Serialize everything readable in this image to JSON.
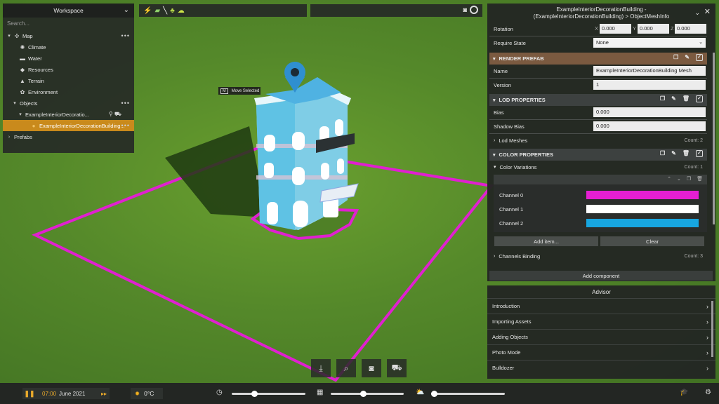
{
  "workspace": {
    "title": "Workspace",
    "search_placeholder": "Search...",
    "tree": [
      {
        "label": "Map",
        "icon": "map-icon",
        "twisty": "▾",
        "depth": 0
      },
      {
        "label": "Climate",
        "icon": "climate-icon",
        "twisty": "",
        "depth": 1
      },
      {
        "label": "Water",
        "icon": "water-icon",
        "twisty": "",
        "depth": 1
      },
      {
        "label": "Resources",
        "icon": "resources-icon",
        "twisty": "",
        "depth": 1
      },
      {
        "label": "Terrain",
        "icon": "terrain-icon",
        "twisty": "",
        "depth": 1
      },
      {
        "label": "Environment",
        "icon": "environment-icon",
        "twisty": "",
        "depth": 1
      },
      {
        "label": "Objects",
        "icon": "",
        "twisty": "▾",
        "depth": 1
      },
      {
        "label": "ExampleInteriorDecoratio...",
        "icon": "",
        "twisty": "▾",
        "depth": 2
      },
      {
        "label": "ExampleInteriorDecorationBuilding...",
        "icon": "dot-icon",
        "twisty": "",
        "depth": 3,
        "selected": true
      },
      {
        "label": "Prefabs",
        "icon": "",
        "twisty": "›",
        "depth": 0
      }
    ]
  },
  "tooltip": {
    "key": "M",
    "text": "Move Selected"
  },
  "inspector": {
    "title_line1": "ExampleInteriorDecorationBuilding -",
    "title_line2": "(ExampleInteriorDecorationBuilding) > ObjectMeshInfo",
    "rotation_label": "Rotation",
    "rotation": {
      "x_label": "X",
      "x": "0.000",
      "y_label": "Y",
      "y": "0.000",
      "z_label": "Z",
      "z": "0.000"
    },
    "require_state_label": "Require State",
    "require_state_value": "None",
    "render_prefab_title": "RENDER PREFAB",
    "name_label": "Name",
    "name_value": "ExampleInteriorDecorationBuilding Mesh",
    "version_label": "Version",
    "version_value": "1",
    "lod_title": "LOD PROPERTIES",
    "bias_label": "Bias",
    "bias_value": "0.000",
    "shadow_bias_label": "Shadow Bias",
    "shadow_bias_value": "0.000",
    "lod_meshes_label": "Lod Meshes",
    "lod_meshes_count": "Count: 2",
    "color_title": "COLOR PROPERTIES",
    "color_variations_label": "Color Variations",
    "color_variations_count": "Count: 1",
    "channels": [
      {
        "label": "Channel 0",
        "color": "#e51fd2"
      },
      {
        "label": "Channel 1",
        "color": "#ffffff"
      },
      {
        "label": "Channel 2",
        "color": "#17a6e0"
      }
    ],
    "add_item_label": "Add item...",
    "clear_label": "Clear",
    "channels_binding_label": "Channels Binding",
    "channels_binding_count": "Count: 3",
    "add_component_label": "Add component"
  },
  "advisor": {
    "title": "Advisor",
    "items": [
      "Introduction",
      "Importing Assets",
      "Adding Objects",
      "Photo Mode",
      "Bulldozer"
    ]
  },
  "bottom_bar": {
    "time": "07:00",
    "date": "June 2021",
    "temperature": "0°C"
  },
  "colors": {
    "accent": "#e9a92b",
    "selection": "#c98a1c",
    "outline": "#e020d0",
    "render_prefab_header": "#7b5a40"
  }
}
